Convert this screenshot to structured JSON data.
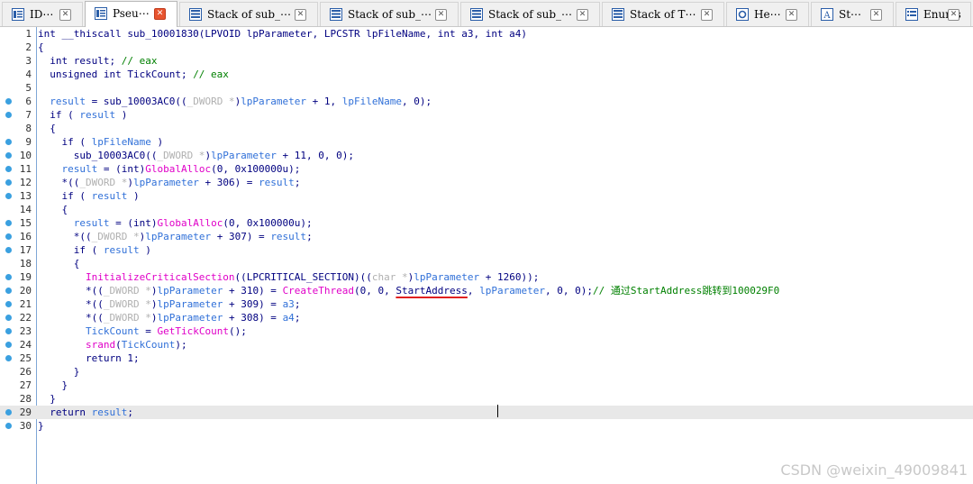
{
  "tabs": [
    {
      "label": "ID⋯",
      "icon": "view-icon",
      "active": false
    },
    {
      "label": "Pseu⋯",
      "icon": "view-icon",
      "active": true
    },
    {
      "label": "Stack of sub_⋯",
      "icon": "stack-icon",
      "active": false
    },
    {
      "label": "Stack of sub_⋯",
      "icon": "stack-icon",
      "active": false
    },
    {
      "label": "Stack of sub_⋯",
      "icon": "stack-icon",
      "active": false
    },
    {
      "label": "Stack of T⋯",
      "icon": "stack-icon",
      "active": false
    },
    {
      "label": "He⋯",
      "icon": "hex-icon",
      "active": false
    },
    {
      "label": "St⋯",
      "icon": "string-icon",
      "active": false
    },
    {
      "label": "Enums",
      "icon": "enum-icon",
      "active": false
    }
  ],
  "tab_close_symbol": "✕",
  "code_lines": [
    {
      "n": "1",
      "dot": false,
      "segs": [
        [
          "k",
          "int __thiscall sub_10001830(LPVOID lpParameter, LPCSTR lpFileName, int a3, int a4)"
        ]
      ]
    },
    {
      "n": "2",
      "dot": false,
      "segs": [
        [
          "k",
          "{"
        ]
      ]
    },
    {
      "n": "3",
      "dot": false,
      "segs": [
        [
          "k",
          "  int result; "
        ],
        [
          "c",
          "// eax"
        ]
      ]
    },
    {
      "n": "4",
      "dot": false,
      "segs": [
        [
          "k",
          "  unsigned int TickCount; "
        ],
        [
          "c",
          "// eax"
        ]
      ]
    },
    {
      "n": "5",
      "dot": false,
      "segs": []
    },
    {
      "n": "6",
      "dot": true,
      "segs": [
        [
          "v",
          "  result"
        ],
        [
          "k",
          " = sub_10003AC0(("
        ],
        [
          "m",
          "_DWORD *"
        ],
        [
          "k",
          ")"
        ],
        [
          "v",
          "lpParameter"
        ],
        [
          "k",
          " + 1, "
        ],
        [
          "v",
          "lpFileName"
        ],
        [
          "k",
          ", 0);"
        ]
      ]
    },
    {
      "n": "7",
      "dot": true,
      "segs": [
        [
          "k",
          "  if ( "
        ],
        [
          "v",
          "result"
        ],
        [
          "k",
          " )"
        ]
      ]
    },
    {
      "n": "8",
      "dot": false,
      "segs": [
        [
          "k",
          "  {"
        ]
      ]
    },
    {
      "n": "9",
      "dot": true,
      "segs": [
        [
          "k",
          "    if ( "
        ],
        [
          "v",
          "lpFileName"
        ],
        [
          "k",
          " )"
        ]
      ]
    },
    {
      "n": "10",
      "dot": true,
      "segs": [
        [
          "k",
          "      sub_10003AC0(("
        ],
        [
          "m",
          "_DWORD *"
        ],
        [
          "k",
          ")"
        ],
        [
          "v",
          "lpParameter"
        ],
        [
          "k",
          " + 11, 0, 0);"
        ]
      ]
    },
    {
      "n": "11",
      "dot": true,
      "segs": [
        [
          "v",
          "    result"
        ],
        [
          "k",
          " = (int)"
        ],
        [
          "f",
          "GlobalAlloc"
        ],
        [
          "k",
          "(0, 0x100000u);"
        ]
      ]
    },
    {
      "n": "12",
      "dot": true,
      "segs": [
        [
          "k",
          "    *(("
        ],
        [
          "m",
          "_DWORD *"
        ],
        [
          "k",
          ")"
        ],
        [
          "v",
          "lpParameter"
        ],
        [
          "k",
          " + 306) = "
        ],
        [
          "v",
          "result"
        ],
        [
          "k",
          ";"
        ]
      ]
    },
    {
      "n": "13",
      "dot": true,
      "segs": [
        [
          "k",
          "    if ( "
        ],
        [
          "v",
          "result"
        ],
        [
          "k",
          " )"
        ]
      ]
    },
    {
      "n": "14",
      "dot": false,
      "segs": [
        [
          "k",
          "    {"
        ]
      ]
    },
    {
      "n": "15",
      "dot": true,
      "segs": [
        [
          "v",
          "      result"
        ],
        [
          "k",
          " = (int)"
        ],
        [
          "f",
          "GlobalAlloc"
        ],
        [
          "k",
          "(0, 0x100000u);"
        ]
      ]
    },
    {
      "n": "16",
      "dot": true,
      "segs": [
        [
          "k",
          "      *(("
        ],
        [
          "m",
          "_DWORD *"
        ],
        [
          "k",
          ")"
        ],
        [
          "v",
          "lpParameter"
        ],
        [
          "k",
          " + 307) = "
        ],
        [
          "v",
          "result"
        ],
        [
          "k",
          ";"
        ]
      ]
    },
    {
      "n": "17",
      "dot": true,
      "segs": [
        [
          "k",
          "      if ( "
        ],
        [
          "v",
          "result"
        ],
        [
          "k",
          " )"
        ]
      ]
    },
    {
      "n": "18",
      "dot": false,
      "segs": [
        [
          "k",
          "      {"
        ]
      ]
    },
    {
      "n": "19",
      "dot": true,
      "segs": [
        [
          "f",
          "        InitializeCriticalSection"
        ],
        [
          "k",
          "((LPCRITICAL_SECTION)(("
        ],
        [
          "m",
          "char *"
        ],
        [
          "k",
          ")"
        ],
        [
          "v",
          "lpParameter"
        ],
        [
          "k",
          " + 1260));"
        ]
      ]
    },
    {
      "n": "20",
      "dot": true,
      "segs": [
        [
          "k",
          "        *(("
        ],
        [
          "m",
          "_DWORD *"
        ],
        [
          "k",
          ")"
        ],
        [
          "v",
          "lpParameter"
        ],
        [
          "k",
          " + 310) = "
        ],
        [
          "f",
          "CreateThread"
        ],
        [
          "k",
          "(0, 0, "
        ],
        [
          "u",
          "StartAddress"
        ],
        [
          "k",
          ", "
        ],
        [
          "v",
          "lpParameter"
        ],
        [
          "k",
          ", 0, 0);"
        ],
        [
          "c",
          "// 通过StartAddress跳转到100029F0"
        ]
      ]
    },
    {
      "n": "21",
      "dot": true,
      "segs": [
        [
          "k",
          "        *(("
        ],
        [
          "m",
          "_DWORD *"
        ],
        [
          "k",
          ")"
        ],
        [
          "v",
          "lpParameter"
        ],
        [
          "k",
          " + 309) = "
        ],
        [
          "v",
          "a3"
        ],
        [
          "k",
          ";"
        ]
      ]
    },
    {
      "n": "22",
      "dot": true,
      "segs": [
        [
          "k",
          "        *(("
        ],
        [
          "m",
          "_DWORD *"
        ],
        [
          "k",
          ")"
        ],
        [
          "v",
          "lpParameter"
        ],
        [
          "k",
          " + 308) = "
        ],
        [
          "v",
          "a4"
        ],
        [
          "k",
          ";"
        ]
      ]
    },
    {
      "n": "23",
      "dot": true,
      "segs": [
        [
          "v",
          "        TickCount"
        ],
        [
          "k",
          " = "
        ],
        [
          "f",
          "GetTickCount"
        ],
        [
          "k",
          "();"
        ]
      ]
    },
    {
      "n": "24",
      "dot": true,
      "segs": [
        [
          "f",
          "        srand"
        ],
        [
          "k",
          "("
        ],
        [
          "v",
          "TickCount"
        ],
        [
          "k",
          ");"
        ]
      ]
    },
    {
      "n": "25",
      "dot": true,
      "segs": [
        [
          "k",
          "        return 1;"
        ]
      ]
    },
    {
      "n": "26",
      "dot": false,
      "segs": [
        [
          "k",
          "      }"
        ]
      ]
    },
    {
      "n": "27",
      "dot": false,
      "segs": [
        [
          "k",
          "    }"
        ]
      ]
    },
    {
      "n": "28",
      "dot": false,
      "segs": [
        [
          "k",
          "  }"
        ]
      ]
    },
    {
      "n": "29",
      "dot": true,
      "highlight": true,
      "segs": [
        [
          "k",
          "  return "
        ],
        [
          "v",
          "result"
        ],
        [
          "k",
          ";"
        ]
      ]
    },
    {
      "n": "30",
      "dot": true,
      "segs": [
        [
          "k",
          "}"
        ]
      ]
    }
  ],
  "watermark": "CSDN @weixin_49009841"
}
